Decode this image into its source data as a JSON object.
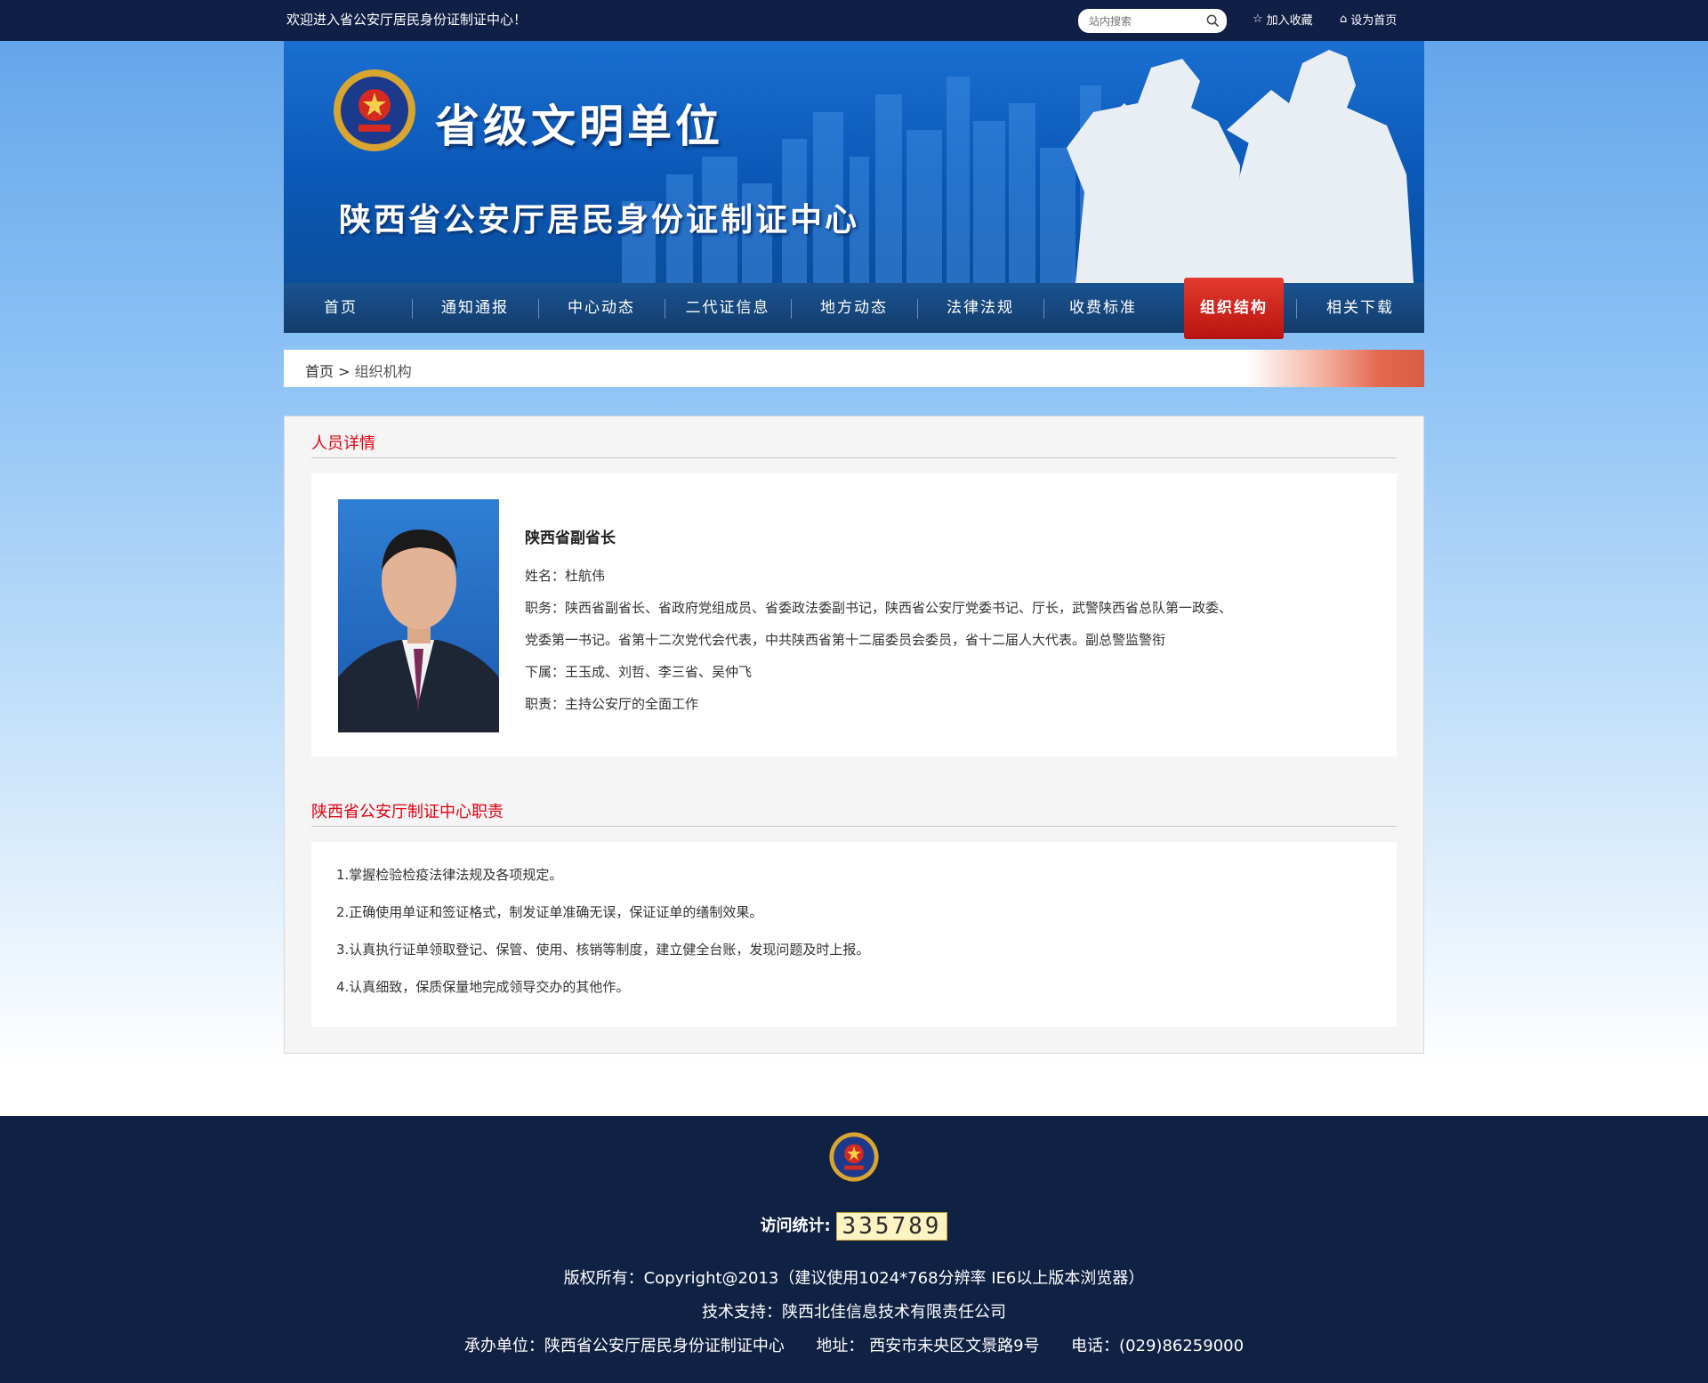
{
  "topbar": {
    "welcome": "欢迎进入省公安厅居民身份证制证中心！",
    "search_placeholder": "站内搜索",
    "favorite": "加入收藏",
    "homepage": "设为首页"
  },
  "banner": {
    "title1": "省级文明单位",
    "title2": "陕西省公安厅居民身份证制证中心"
  },
  "nav": {
    "items": [
      "首页",
      "通知通报",
      "中心动态",
      "二代证信息",
      "地方动态",
      "法律法规",
      "收费标准",
      "组织结构",
      "相关下载"
    ],
    "active_index": 7
  },
  "breadcrumb": {
    "home": "首页",
    "sep": " > ",
    "current": "组织机构"
  },
  "person_section": {
    "title": "人员详情",
    "heading": "陕西省副省长",
    "name": "姓名：杜航伟",
    "position_line1": "职务：陕西省副省长、省政府党组成员、省委政法委副书记，陕西省公安厅党委书记、厅长，武警陕西省总队第一政委、",
    "position_line2": "党委第一书记。省第十二次党代会代表，中共陕西省第十二届委员会委员，省十二届人大代表。副总警监警衔",
    "subordinates": "下属：王玉成、刘哲、李三省、吴仲飞",
    "responsibility": "职责：主持公安厅的全面工作"
  },
  "duty_section": {
    "title": "陕西省公安厅制证中心职责",
    "items": [
      "1.掌握检验检疫法律法规及各项规定。",
      "2.正确使用单证和签证格式，制发证单准确无误，保证证单的缮制效果。",
      "3.认真执行证单领取登记、保管、使用、核销等制度，建立健全台账，发现问题及时上报。",
      "4.认真细致，保质保量地完成领导交办的其他作。"
    ]
  },
  "footer": {
    "visit_label": "访问统计:",
    "visit_count": "335789",
    "copyright": "版权所有：Copyright@2013（建议使用1024*768分辨率  IE6以上版本浏览器）",
    "support": "技术支持：陕西北佳信息技术有限责任公司",
    "org": "承办单位：陕西省公安厅居民身份证制证中心",
    "address": "地址： 西安市未央区文景路9号",
    "phone": "电话：(029)86259000"
  },
  "colors": {
    "topbar_bg": "#101f45",
    "accent_red": "#e60012",
    "nav_bg": "#133c6b",
    "footer_bg": "#102244"
  }
}
